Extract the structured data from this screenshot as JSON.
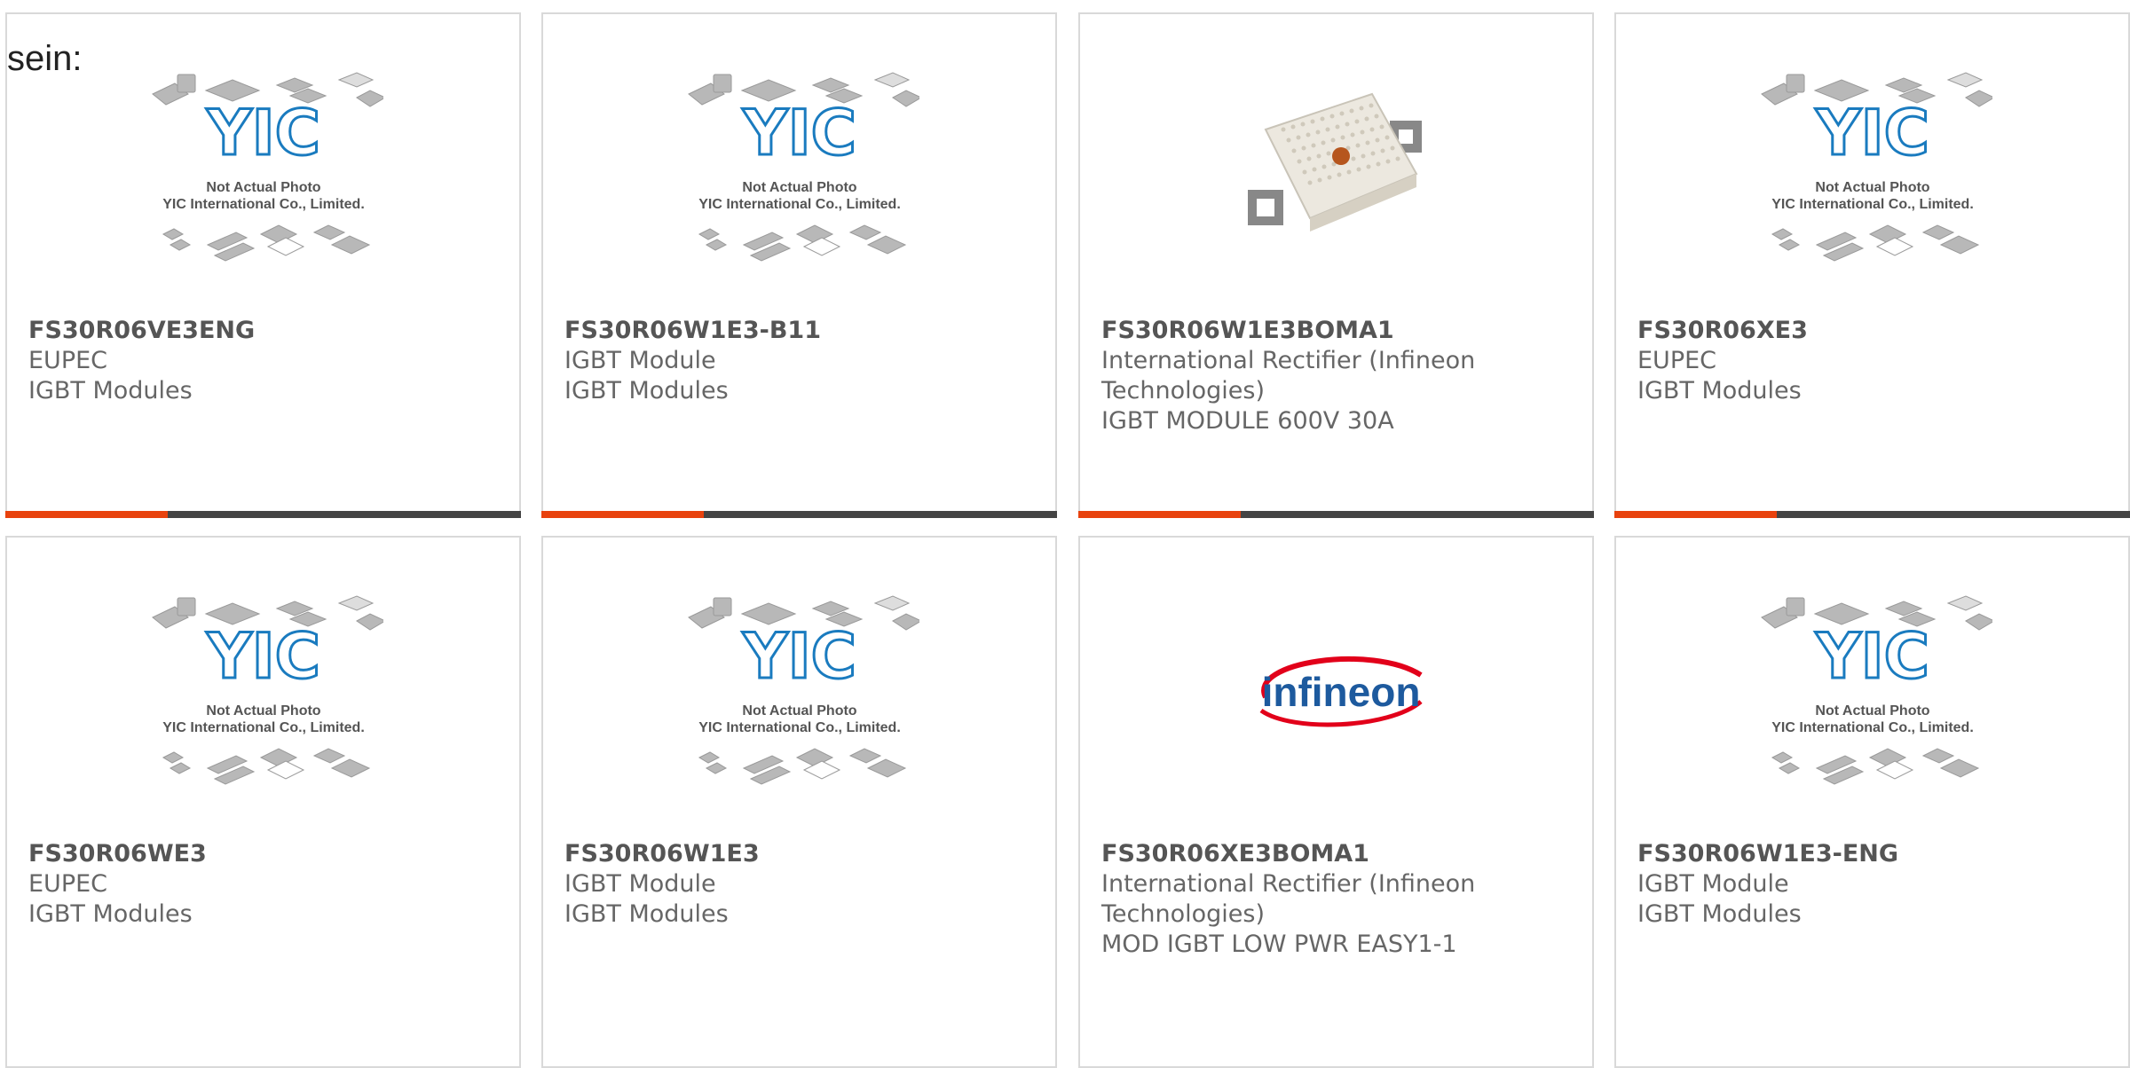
{
  "intro_text": "sein:",
  "colors": {
    "accent": "#e8420e",
    "bar": "#444444",
    "yic_blue": "#1a7bbf"
  },
  "placeholder": {
    "line1": "Not Actual Photo",
    "line2": "YIC International Co., Limited.",
    "logo": "YIC"
  },
  "infineon_logo_text": "infineon",
  "products": [
    {
      "part": "FS30R06VE3ENG",
      "lines": [
        "EUPEC",
        "IGBT Modules"
      ],
      "image": "placeholder"
    },
    {
      "part": "FS30R06W1E3-B11",
      "lines": [
        "IGBT Module",
        "IGBT Modules"
      ],
      "image": "placeholder"
    },
    {
      "part": "FS30R06W1E3BOMA1",
      "lines": [
        "International Rectifier (Infineon Technologies)",
        "IGBT MODULE 600V 30A"
      ],
      "image": "module-photo"
    },
    {
      "part": "FS30R06XE3",
      "lines": [
        "EUPEC",
        "IGBT Modules"
      ],
      "image": "placeholder"
    },
    {
      "part": "FS30R06WE3",
      "lines": [
        "EUPEC",
        "IGBT Modules"
      ],
      "image": "placeholder"
    },
    {
      "part": "FS30R06W1E3",
      "lines": [
        "IGBT Module",
        "IGBT Modules"
      ],
      "image": "placeholder"
    },
    {
      "part": "FS30R06XE3BOMA1",
      "lines": [
        "International Rectifier (Infineon Technologies)",
        "MOD IGBT LOW PWR EASY1-1"
      ],
      "image": "infineon-logo"
    },
    {
      "part": "FS30R06W1E3-ENG",
      "lines": [
        "IGBT Module",
        "IGBT Modules"
      ],
      "image": "placeholder"
    }
  ]
}
